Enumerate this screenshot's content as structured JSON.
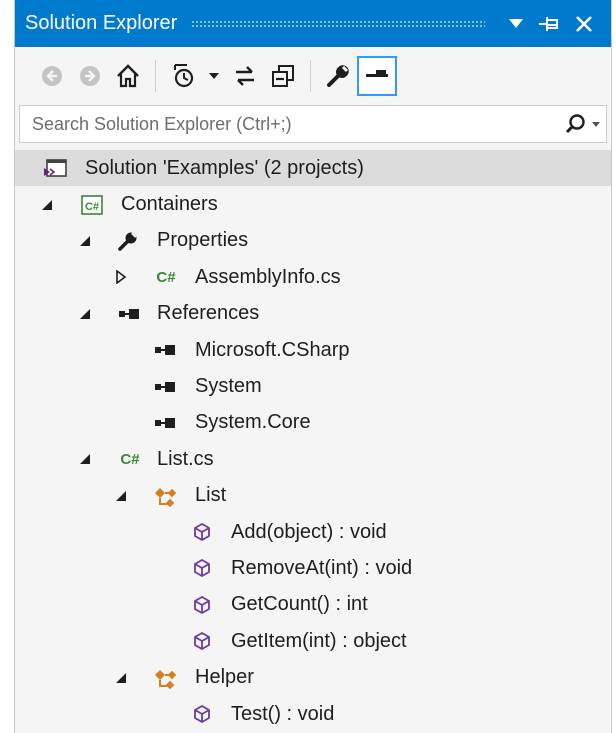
{
  "title_bar": {
    "title": "Solution Explorer",
    "buttons": [
      {
        "icon": "dropdown-arrow-icon"
      },
      {
        "icon": "pin-icon"
      },
      {
        "icon": "close-icon"
      }
    ]
  },
  "toolbar": {
    "items": [
      {
        "icon": "back-icon"
      },
      {
        "icon": "forward-icon"
      },
      {
        "icon": "home-icon"
      },
      {
        "icon": "pending-changes-filter-icon"
      },
      {
        "icon": "dropdown-icon"
      },
      {
        "icon": "sync-with-active-document-icon"
      },
      {
        "icon": "collapse-all-icon"
      },
      {
        "icon": "properties-wrench-icon"
      },
      {
        "icon": "preview-selected-items-icon",
        "active": true
      }
    ],
    "accent": "#3399ff"
  },
  "search": {
    "placeholder": "Search Solution Explorer (Ctrl+;)",
    "icon": "search-icon"
  },
  "tree": {
    "solution": "Solution 'Examples' (2 projects)",
    "project": "Containers",
    "properties": "Properties",
    "assemblyinfo": "AssemblyInfo.cs",
    "references": "References",
    "ref_csharp": "Microsoft.CSharp",
    "ref_system": "System",
    "ref_core": "System.Core",
    "listcs": "List.cs",
    "class_list": "List",
    "m_add": "Add(object) : void",
    "m_removeat": "RemoveAt(int) : void",
    "m_getcount": "GetCount() : int",
    "m_getitem": "GetItem(int) : object",
    "class_helper": "Helper",
    "m_test": "Test() : void"
  },
  "colors": {
    "title_bar": "#007acc",
    "csharp_green": "#388a34",
    "class_orange": "#d67f1e",
    "method_purple": "#6c3b9e",
    "selected_row": "#dcdcdc"
  }
}
